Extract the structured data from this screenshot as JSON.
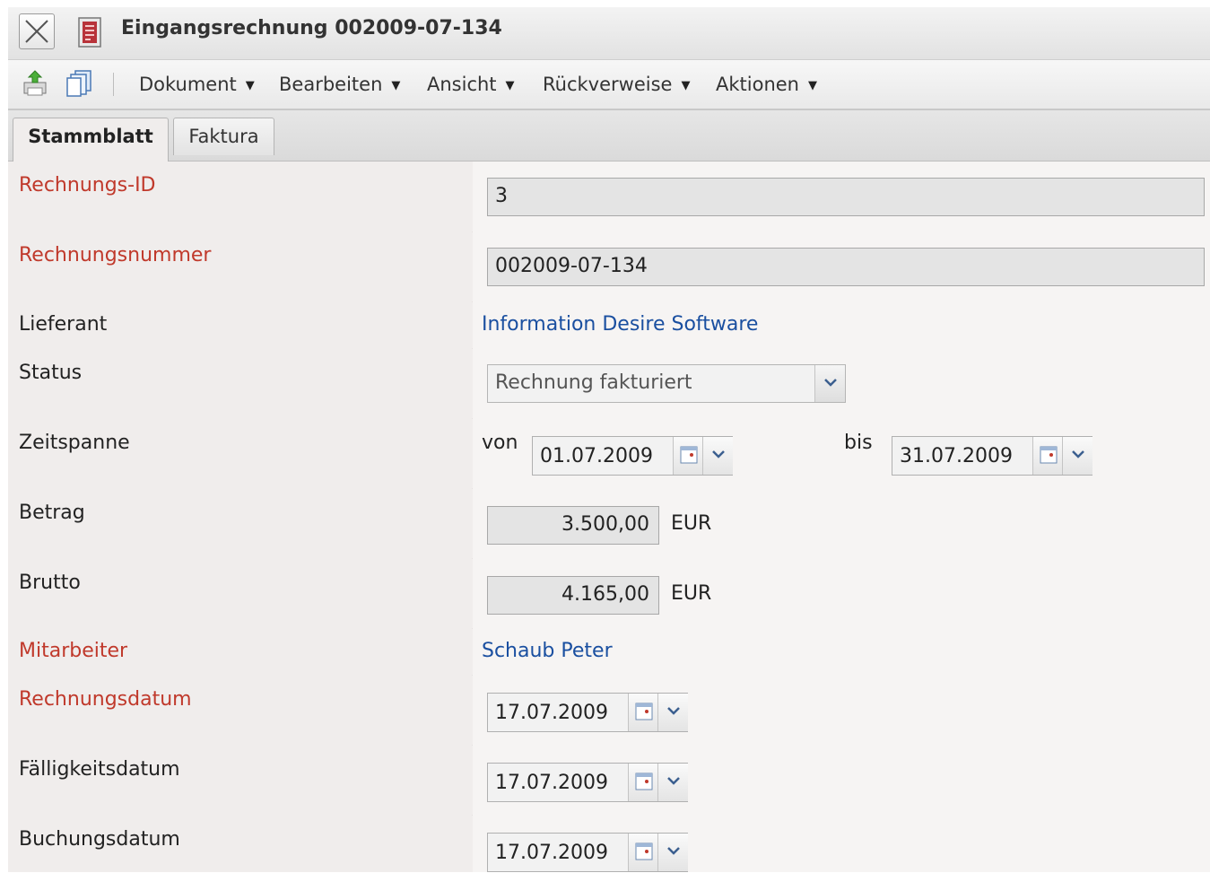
{
  "window": {
    "title": "Eingangsrechnung 002009-07-134"
  },
  "toolbar": {
    "menus": [
      "Dokument",
      "Bearbeiten",
      "Ansicht",
      "Rückverweise",
      "Aktionen"
    ]
  },
  "tabs": [
    {
      "label": "Stammblatt",
      "active": true
    },
    {
      "label": "Faktura",
      "active": false
    }
  ],
  "form": {
    "rechnungs_id": {
      "label": "Rechnungs-ID",
      "value": "3"
    },
    "rechnungsnummer": {
      "label": "Rechnungsnummer",
      "value": "002009-07-134"
    },
    "lieferant": {
      "label": "Lieferant",
      "value": "Information Desire Software"
    },
    "status": {
      "label": "Status",
      "value": "Rechnung fakturiert"
    },
    "zeitspanne": {
      "label": "Zeitspanne",
      "von_label": "von",
      "von": "01.07.2009",
      "bis_label": "bis",
      "bis": "31.07.2009"
    },
    "betrag": {
      "label": "Betrag",
      "value": "3.500,00",
      "currency": "EUR"
    },
    "brutto": {
      "label": "Brutto",
      "value": "4.165,00",
      "currency": "EUR"
    },
    "mitarbeiter": {
      "label": "Mitarbeiter",
      "value": "Schaub Peter"
    },
    "rechnungsdatum": {
      "label": "Rechnungsdatum",
      "value": "17.07.2009"
    },
    "faelligkeitsdatum": {
      "label": "Fälligkeitsdatum",
      "value": "17.07.2009"
    },
    "buchungsdatum": {
      "label": "Buchungsdatum",
      "value": "17.07.2009"
    }
  },
  "colors": {
    "required_label": "#c0392b",
    "link": "#1a4fa0"
  }
}
